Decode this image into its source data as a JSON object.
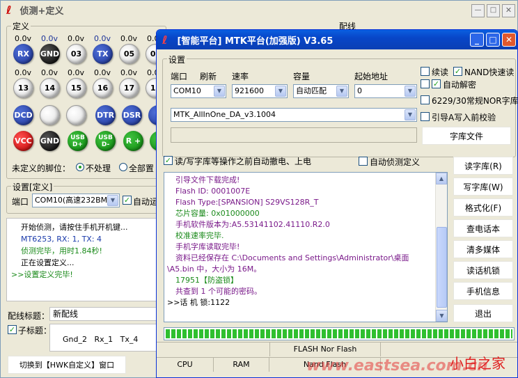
{
  "bg_window": {
    "title": "侦测+定义",
    "section_define": "定义",
    "section_wiring": "配线",
    "row1_volts": [
      "0.0v",
      "0.0v",
      "0.0v",
      "0.0v",
      "0.0v",
      "0.0"
    ],
    "row1_pins": [
      "RX",
      "GND",
      "03",
      "TX",
      "05",
      "06"
    ],
    "row2_volts": [
      "0.0v",
      "0.0v",
      "0.0v",
      "0.0v",
      "0.0v",
      "0.0v"
    ],
    "row2_pins": [
      "13",
      "14",
      "15",
      "16",
      "17",
      "18"
    ],
    "row3_pins": [
      "DCD",
      "",
      "",
      "DTR",
      "DSR",
      "R"
    ],
    "row4_pins": [
      "VCC",
      "GND",
      "USB D+",
      "USB D-",
      "R +",
      "R"
    ],
    "undefined_pin_label": "未定义的脚位：",
    "radio_no_process": "不处理",
    "radio_all_set": "全部置",
    "settings_group": "设置[定义]",
    "port_label": "端口",
    "port_value": "COM10(高速232BM)",
    "auto_run_label": "自动运",
    "log_lines": [
      {
        "text": "开始侦测，请按住手机开机键...",
        "color": "#000000"
      },
      {
        "text": "MT6253, RX: 1, TX: 4",
        "color": "#1a3aaa"
      },
      {
        "text": "侦测完毕，用时1.84秒!",
        "color": "#1a8a1a"
      },
      {
        "text": "正在设置定义...",
        "color": "#000000"
      },
      {
        "text": ">>设置定义完毕!",
        "color": "#1a8a1a"
      }
    ],
    "wiring_title_label": "配线标题：",
    "wiring_title_value": "新配线",
    "subtitle_label": "子标题：",
    "subtitle_value": "Gnd_2   Rx_1   Tx_4",
    "switch_button": "切换到【HWK自定义】窗口"
  },
  "fg_window": {
    "title": "[智能平台] MTK平台(加强版) V3.65",
    "settings_group": "设置",
    "port_label": "端口",
    "refresh_label": "刷新",
    "baud_label": "速率",
    "capacity_label": "容量",
    "start_addr_label": "起始地址",
    "port_value": "COM10",
    "baud_value": "921600",
    "capacity_value": "自动匹配",
    "start_addr_value": "0",
    "da_file_value": "MTK_AllInOne_DA_v3.1004",
    "opt_continue_read": "续读",
    "opt_nand_fast_read": "NAND快速读",
    "opt_auto_decrypt": "自动解密",
    "opt_6229": "6229/30常规NOR字库",
    "opt_verify": "引导A写入前校验",
    "font_file_button": "字库文件",
    "auto_power_label": "读/写字库等操作之前自动撤电、上电",
    "auto_detect_label": "自动侦测定义",
    "log_lines": [
      {
        "text": "引导文件下载完成!",
        "color": "#7a1a8a"
      },
      {
        "text": "Flash ID: 0001007E",
        "color": "#7a1a8a"
      },
      {
        "text": "Flash Type:[SPANSION] S29VS128R_T",
        "color": "#7a1a8a"
      },
      {
        "text": "芯片容量: 0x01000000",
        "color": "#1a8a1a"
      },
      {
        "text": "手机软件版本为:A5.53141102.41110.R2.0",
        "color": "#7a1a8a"
      },
      {
        "text": "校准速率完毕.",
        "color": "#1a8a1a"
      },
      {
        "text": "手机字库读取完毕!",
        "color": "#7a1a8a"
      },
      {
        "text": "资料已经保存在 C:\\Documents and Settings\\Administrator\\桌面",
        "color": "#7a1a8a"
      },
      {
        "text": "\\A5.bin 中，大小为 16M。",
        "color": "#7a1a8a"
      },
      {
        "text": "17951【防盗锁】",
        "color": "#1a8a1a"
      },
      {
        "text": "共查到 1 个可能的密码。",
        "color": "#7a1a8a"
      },
      {
        "text": ">>话 机 锁:1122",
        "color": "#000000"
      }
    ],
    "side_buttons": [
      "读字库(R)",
      "写字库(W)",
      "格式化(F)",
      "查电话本",
      "清多媒体",
      "读话机锁",
      "手机信息",
      "退出"
    ],
    "progress_fraction": 1.0,
    "status_flash": "FLASH Nor Flash",
    "status_cpu": "CPU",
    "status_ram": "RAM",
    "status_nand": "Nand Flash"
  },
  "watermark": {
    "url": "www.eastsea.com.cn",
    "brand": "小白之家"
  }
}
